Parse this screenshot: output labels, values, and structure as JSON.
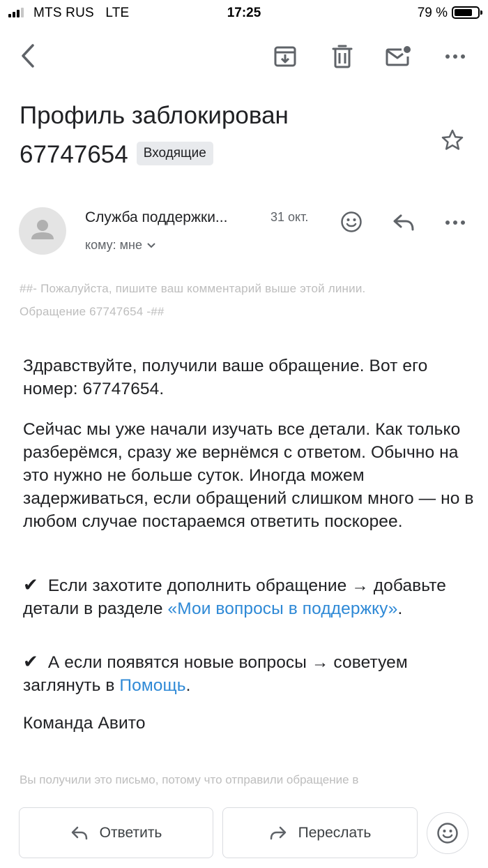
{
  "status_bar": {
    "carrier": "MTS RUS",
    "network": "LTE",
    "time": "17:25",
    "battery_percent": "79 %",
    "battery_level": 0.79
  },
  "toolbar": {
    "icons": [
      "back-icon",
      "archive-icon",
      "trash-icon",
      "mark-unread-icon",
      "more-vertical-icon"
    ]
  },
  "email": {
    "subject_line1": "Профиль заблокирован",
    "subject_line2": "67747654",
    "label": "Входящие",
    "sender": "Служба поддержки...",
    "date": "31 окт.",
    "recipient": "кому: мне",
    "quote_line1": "##- Пожалуйста, пишите ваш комментарий выше этой линии.",
    "quote_line2": "Обращение 67747654 -##",
    "body": {
      "greeting": "Здравствуйте, получили ваше обращение. Вот его номер: 67747654.",
      "paragraph2": "Сейчас мы уже начали изучать все детали. Как только разберёмся, сразу же вернёмся с ответом. Обычно на это нужно не больше суток. Иногда можем задерживаться, если обращений слишком много — но в любом случае постараемся ответить поскорее.",
      "check_mark": "✔",
      "bullet1_text": "Если захотите дополнить обращение → добавьте детали в разделе ",
      "bullet1_link": "«Мои вопросы в поддержку»",
      "bullet1_end": ".",
      "bullet2_text": "А если появятся новые вопросы → советуем заглянуть в ",
      "bullet2_link": "Помощь",
      "bullet2_end": ".",
      "signature": "Команда Авито"
    },
    "footer_note": "Вы получили это письмо, потому что отправили обращение в"
  },
  "actions": {
    "reply_label": "Ответить",
    "forward_label": "Переслать"
  },
  "colors": {
    "link": "#2e89d6",
    "secondary_text": "#5f6368",
    "muted_text": "#bdbdbd",
    "icon": "#5f6368"
  }
}
